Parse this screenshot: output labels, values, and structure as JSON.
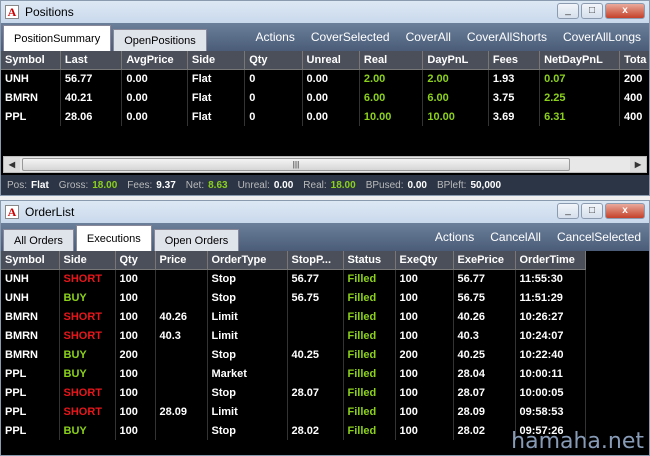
{
  "positions": {
    "title": "Positions",
    "window_buttons": [
      "_",
      "□",
      "x"
    ],
    "tabs": [
      "PositionSummary",
      "OpenPositions"
    ],
    "actions": [
      "Actions",
      "CoverSelected",
      "CoverAll",
      "CoverAllShorts",
      "CoverAllLongs"
    ],
    "columns": [
      "Symbol",
      "Last",
      "AvgPrice",
      "Side",
      "Qty",
      "Unreal",
      "Real",
      "DayPnL",
      "Fees",
      "NetDayPnL",
      "Tota"
    ],
    "rows": [
      [
        "UNH",
        "56.77",
        "0.00",
        "Flat",
        "0",
        "0.00",
        "2.00",
        "2.00",
        "1.93",
        "0.07",
        "200"
      ],
      [
        "BMRN",
        "40.21",
        "0.00",
        "Flat",
        "0",
        "0.00",
        "6.00",
        "6.00",
        "3.75",
        "2.25",
        "400"
      ],
      [
        "PPL",
        "28.06",
        "0.00",
        "Flat",
        "0",
        "0.00",
        "10.00",
        "10.00",
        "3.69",
        "6.31",
        "400"
      ]
    ],
    "status": [
      {
        "label": "Pos:",
        "value": "Flat"
      },
      {
        "label": "Gross:",
        "value": "18.00",
        "green": true
      },
      {
        "label": "Fees:",
        "value": "9.37"
      },
      {
        "label": "Net:",
        "value": "8.63",
        "green": true
      },
      {
        "label": "Unreal:",
        "value": "0.00"
      },
      {
        "label": "Real:",
        "value": "18.00",
        "green": true
      },
      {
        "label": "BPused:",
        "value": "0.00"
      },
      {
        "label": "BPleft:",
        "value": "50,000"
      }
    ]
  },
  "orderlist": {
    "title": "OrderList",
    "window_buttons": [
      "_",
      "□",
      "x"
    ],
    "tabs": [
      "All Orders",
      "Executions",
      "Open Orders"
    ],
    "actions": [
      "Actions",
      "CancelAll",
      "CancelSelected"
    ],
    "columns": [
      "Symbol",
      "Side",
      "Qty",
      "Price",
      "OrderType",
      "StopP...",
      "Status",
      "ExeQty",
      "ExePrice",
      "OrderTime"
    ],
    "rows": [
      [
        "UNH",
        "SHORT",
        "100",
        "",
        "Stop",
        "56.77",
        "Filled",
        "100",
        "56.77",
        "11:55:30"
      ],
      [
        "UNH",
        "BUY",
        "100",
        "",
        "Stop",
        "56.75",
        "Filled",
        "100",
        "56.75",
        "11:51:29"
      ],
      [
        "BMRN",
        "SHORT",
        "100",
        "40.26",
        "Limit",
        "",
        "Filled",
        "100",
        "40.26",
        "10:26:27"
      ],
      [
        "BMRN",
        "SHORT",
        "100",
        "40.3",
        "Limit",
        "",
        "Filled",
        "100",
        "40.3",
        "10:24:07"
      ],
      [
        "BMRN",
        "BUY",
        "200",
        "",
        "Stop",
        "40.25",
        "Filled",
        "200",
        "40.25",
        "10:22:40"
      ],
      [
        "PPL",
        "BUY",
        "100",
        "",
        "Market",
        "",
        "Filled",
        "100",
        "28.04",
        "10:00:11"
      ],
      [
        "PPL",
        "SHORT",
        "100",
        "",
        "Stop",
        "28.07",
        "Filled",
        "100",
        "28.07",
        "10:00:05"
      ],
      [
        "PPL",
        "SHORT",
        "100",
        "28.09",
        "Limit",
        "",
        "Filled",
        "100",
        "28.09",
        "09:58:53"
      ],
      [
        "PPL",
        "BUY",
        "100",
        "",
        "Stop",
        "28.02",
        "Filled",
        "100",
        "28.02",
        "09:57:26"
      ]
    ]
  },
  "watermark": "hamaha.net",
  "colors": {
    "positive": "#8bd11b",
    "short": "#e8161b",
    "grid_bg": "#000000",
    "header_bg": "#4b4f5a"
  }
}
